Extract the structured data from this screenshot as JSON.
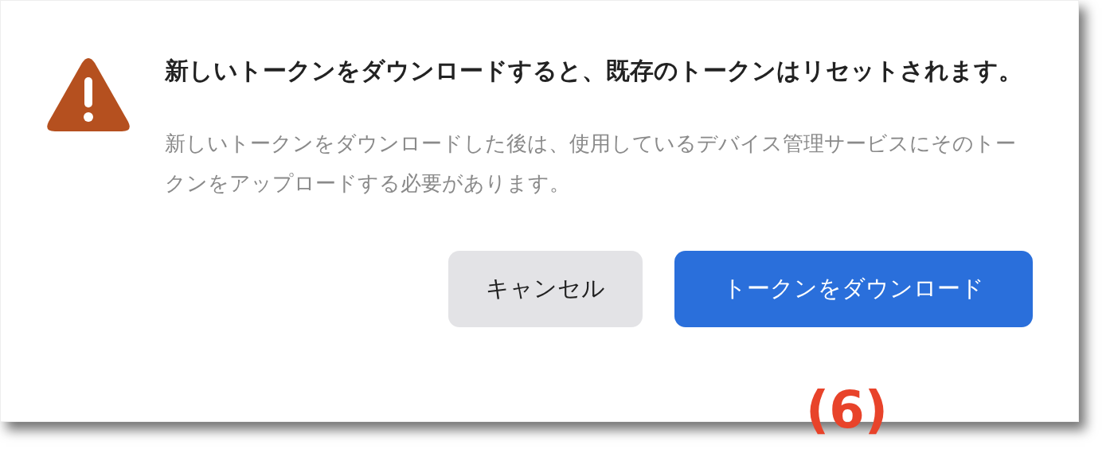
{
  "dialog": {
    "title": "新しいトークンをダウンロードすると、既存のトークンはリセットされます。",
    "message": "新しいトークンをダウンロードした後は、使用しているデバイス管理サービスにそのトークンをアップロードする必要があります。",
    "buttons": [
      {
        "label": "キャンセル",
        "kind": "secondary"
      },
      {
        "label": "トークンをダウンロード",
        "kind": "primary"
      }
    ]
  },
  "annotation": "(6)"
}
